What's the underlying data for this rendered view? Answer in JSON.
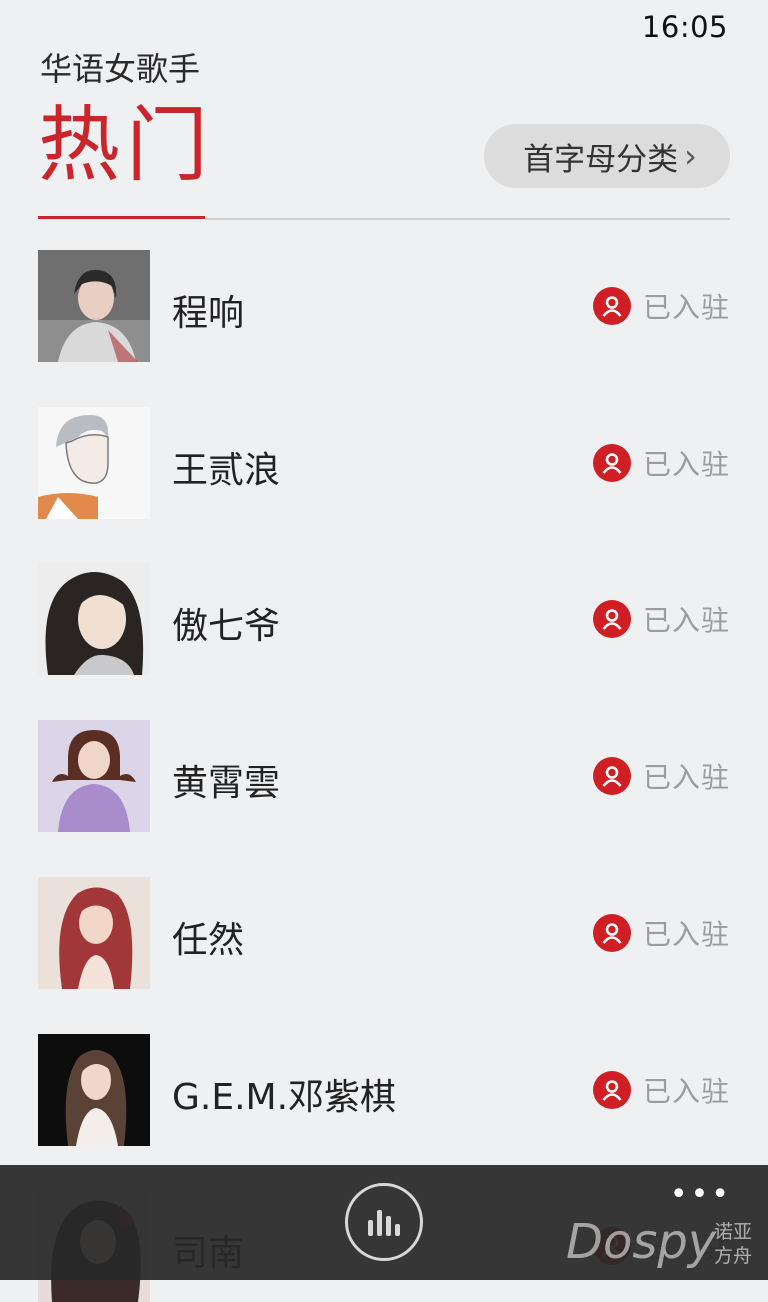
{
  "status": {
    "time": "16:05"
  },
  "header": {
    "app_title": "华语女歌手",
    "pivot": "热门",
    "az_button": "首字母分类"
  },
  "badge_label": "已入驻",
  "artists": [
    {
      "name": "程响"
    },
    {
      "name": "王贰浪"
    },
    {
      "name": "傲七爷"
    },
    {
      "name": "黄霄雲"
    },
    {
      "name": "任然"
    },
    {
      "name": "G.E.M.邓紫棋"
    },
    {
      "name": "司南"
    }
  ],
  "appbar": {
    "more": "•••"
  },
  "watermark": {
    "main": "Dospy",
    "sub1": "诺亚",
    "sub2": "方舟"
  },
  "colors": {
    "accent": "#c9252b",
    "background": "#eff0f2",
    "appbar": "#282828"
  }
}
